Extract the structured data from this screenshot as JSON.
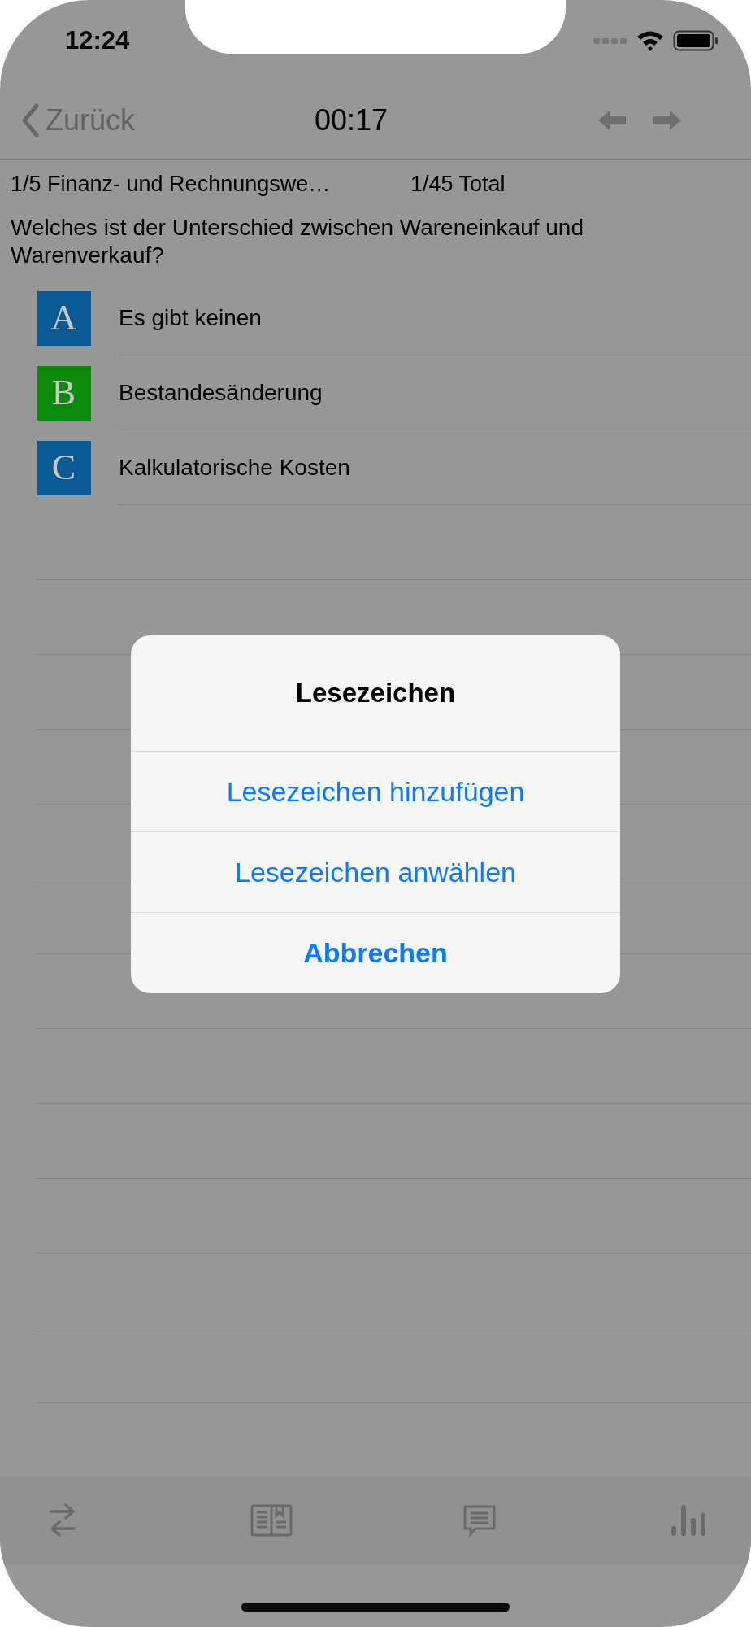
{
  "status_bar": {
    "time": "12:24"
  },
  "nav": {
    "back_label": "Zurück",
    "timer": "00:17"
  },
  "header": {
    "category": "1/5 Finanz- und Rechnungswe…",
    "total": "1/45 Total"
  },
  "question": "Welches ist der Unterschied zwischen Wareneinkauf und Warenverkauf?",
  "answers": [
    {
      "letter": "A",
      "text": "Es gibt keinen",
      "color": "#0a5a96"
    },
    {
      "letter": "B",
      "text": "Bestandesänderung",
      "color": "#0c8a0c"
    },
    {
      "letter": "C",
      "text": "Kalkulatorische Kosten",
      "color": "#0a5a96"
    }
  ],
  "dialog": {
    "title": "Lesezeichen",
    "actions": [
      {
        "label": "Lesezeichen hinzufügen",
        "kind": "default"
      },
      {
        "label": "Lesezeichen anwählen",
        "kind": "default"
      },
      {
        "label": "Abbrechen",
        "kind": "cancel"
      }
    ]
  }
}
